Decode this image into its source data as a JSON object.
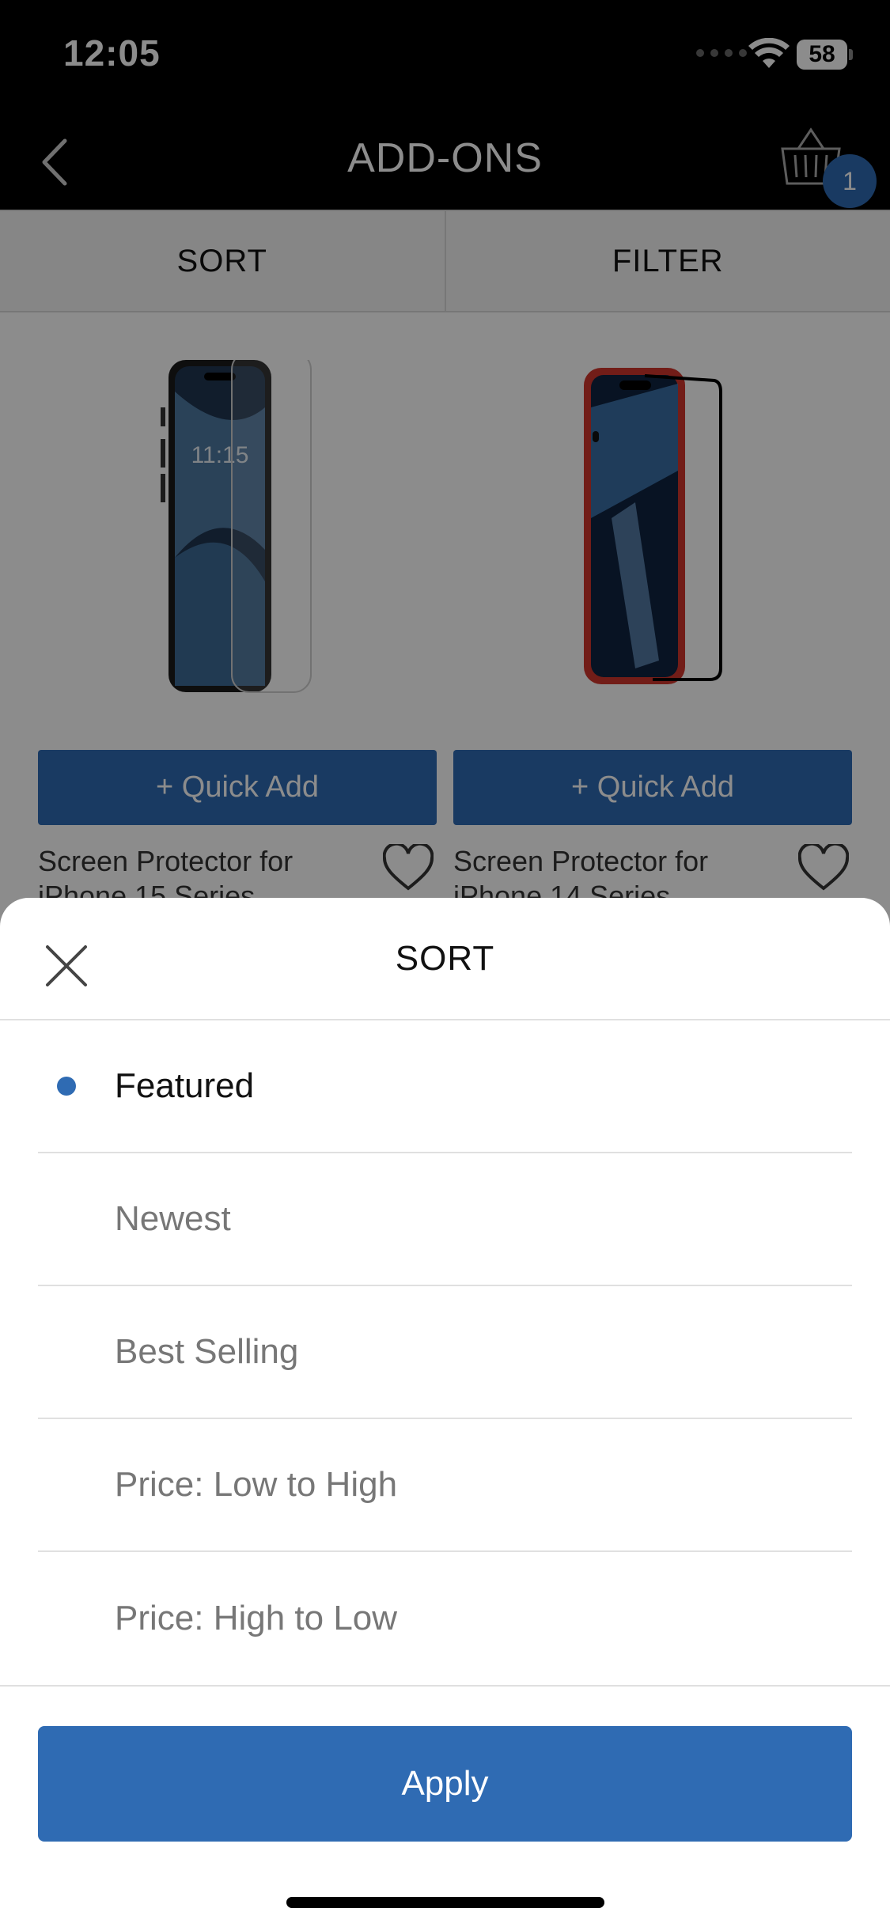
{
  "status_bar": {
    "time": "12:05",
    "battery": "58"
  },
  "nav": {
    "title": "ADD-ONS",
    "cart_count": "1"
  },
  "toolbar": {
    "sort_label": "SORT",
    "filter_label": "FILTER"
  },
  "products": [
    {
      "name": "Screen Protector for iPhone 15 Series",
      "quick_add_label": "+ Quick Add"
    },
    {
      "name": "Screen Protector for iPhone 14 Series",
      "quick_add_label": "+ Quick Add"
    }
  ],
  "sort_sheet": {
    "title": "SORT",
    "options": [
      {
        "label": "Featured",
        "selected": true
      },
      {
        "label": "Newest",
        "selected": false
      },
      {
        "label": "Best Selling",
        "selected": false
      },
      {
        "label": "Price: Low to High",
        "selected": false
      },
      {
        "label": "Price: High to Low",
        "selected": false
      }
    ],
    "apply_label": "Apply"
  },
  "colors": {
    "accent": "#2f6bb3",
    "phone_case_red": "#d0362d"
  }
}
